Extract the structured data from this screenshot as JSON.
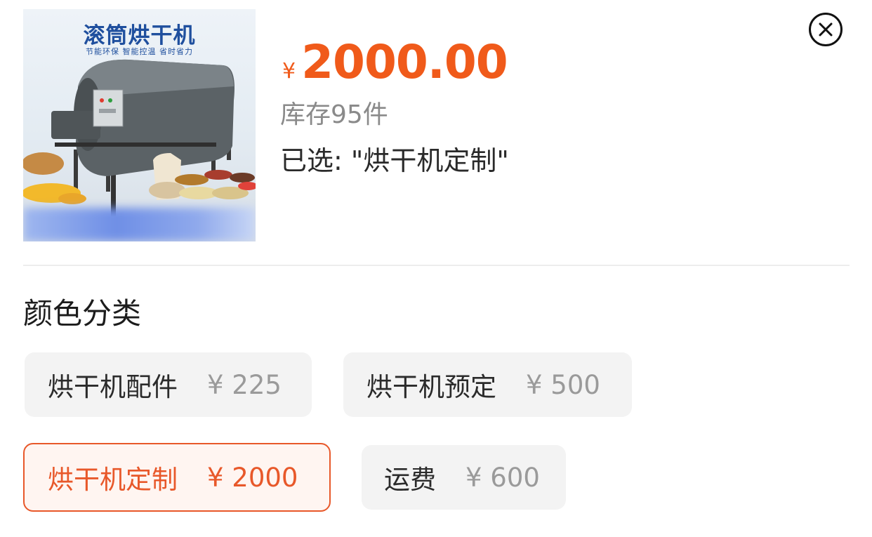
{
  "product": {
    "image_title": "滚筒烘干机",
    "image_subtitle": "节能环保 智能控温 省时省力",
    "currency": "¥",
    "price": "2000.00",
    "stock": "库存95件",
    "selected_label": "已选: \"烘干机定制\""
  },
  "close_icon": "close-circle-icon",
  "section_title": "颜色分类",
  "options": [
    {
      "name": "烘干机配件",
      "price": "¥ 225"
    },
    {
      "name": "烘干机预定",
      "price": "¥ 500"
    },
    {
      "name": "烘干机定制",
      "price": "¥ 2000"
    },
    {
      "name": "运费",
      "price": "¥ 600"
    }
  ],
  "selected_option": "烘干机定制",
  "colors": {
    "accent": "#f05a1a",
    "selected_border": "#e8582a",
    "option_bg": "#f3f3f3",
    "muted_text": "#8a8a8a"
  }
}
